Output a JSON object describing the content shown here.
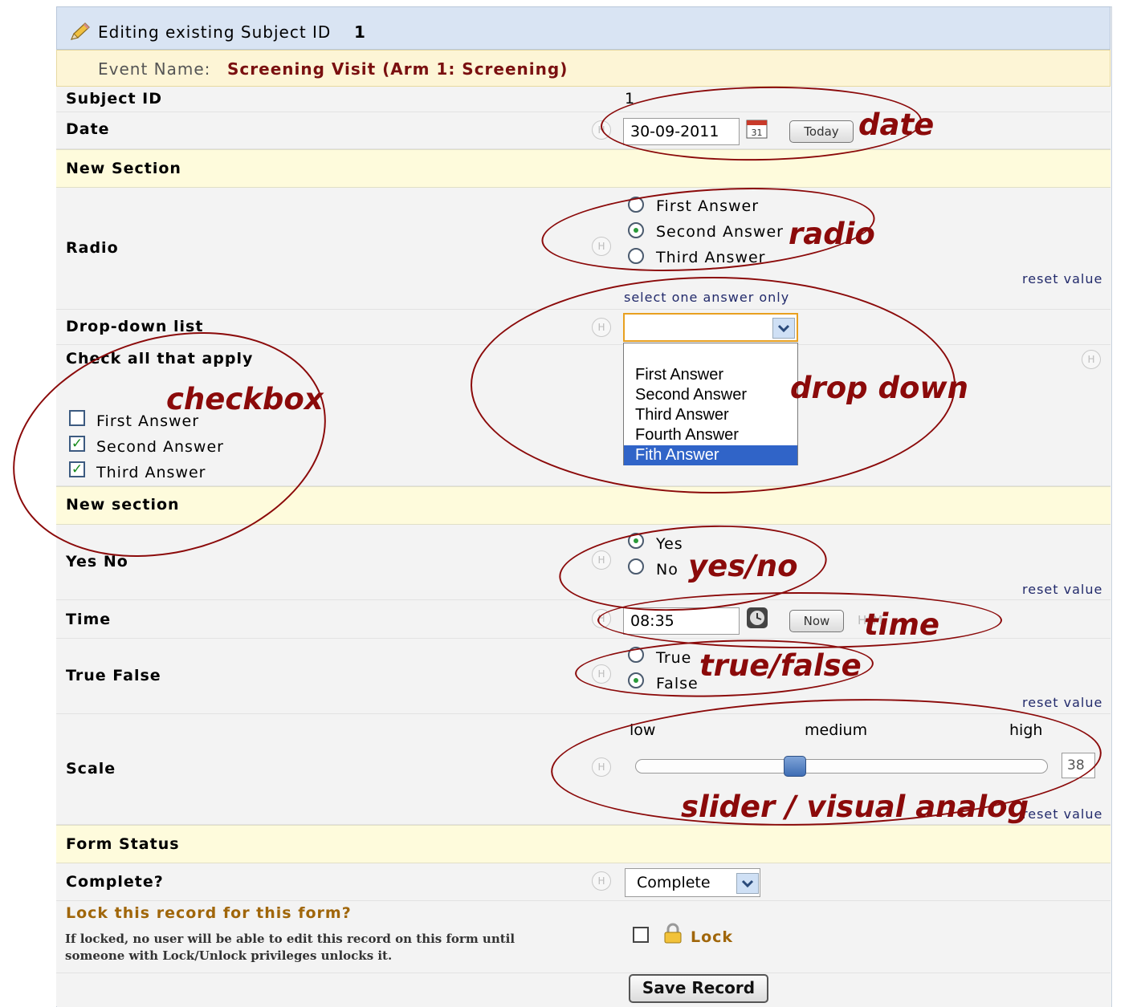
{
  "header": {
    "edit_prefix": "Editing existing Subject ID",
    "subject_number": "1"
  },
  "event": {
    "label": "Event Name:",
    "value": "Screening Visit (Arm 1: Screening)"
  },
  "fields": {
    "subject_id": {
      "label": "Subject ID",
      "value": "1"
    },
    "date": {
      "label": "Date",
      "value": "30-09-2011",
      "today_button": "Today",
      "calendar_day": "31"
    },
    "section1": "New Section",
    "radio": {
      "label": "Radio",
      "options": [
        "First Answer",
        "Second Answer",
        "Third Answer"
      ],
      "selected": "Second Answer",
      "reset": "reset value",
      "hint": "select one answer only"
    },
    "dropdown": {
      "label": "Drop-down list",
      "value": "",
      "options": [
        "First Answer",
        "Second Answer",
        "Third Answer",
        "Fourth Answer",
        "Fith Answer"
      ],
      "highlighted": "Fith Answer"
    },
    "checkbox": {
      "label": "Check all that apply",
      "options": [
        {
          "text": "First Answer",
          "checked": false
        },
        {
          "text": "Second Answer",
          "checked": true
        },
        {
          "text": "Third Answer",
          "checked": true
        }
      ]
    },
    "section2": "New section",
    "yesno": {
      "label": "Yes No",
      "options": [
        "Yes",
        "No"
      ],
      "selected": "Yes",
      "reset": "reset value"
    },
    "time": {
      "label": "Time",
      "value": "08:35",
      "now_button": "Now",
      "format_hint": "H:M"
    },
    "truefalse": {
      "label": "True False",
      "options": [
        "True",
        "False"
      ],
      "selected": "False",
      "reset": "reset value"
    },
    "scale": {
      "label": "Scale",
      "low": "low",
      "medium": "medium",
      "high": "high",
      "value": "38",
      "level": 0.38,
      "reset": "reset value"
    },
    "section3": "Form Status",
    "complete": {
      "label": "Complete?",
      "value": "Complete"
    },
    "lock": {
      "title": "Lock this record for this form?",
      "description_line1": "If locked, no user will be able to edit this record on this form until",
      "description_line2": "someone with Lock/Unlock privileges unlocks it.",
      "checkbox_label": "Lock",
      "checked": false
    },
    "save_button": "Save Record",
    "h_icon": "H"
  },
  "annotations": {
    "date": "date",
    "radio": "radio",
    "dropdown": "drop down",
    "checkbox": "checkbox",
    "yesno": "yes/no",
    "time": "time",
    "truefalse": "true/false",
    "slider": "slider / visual analog"
  },
  "colors": {
    "annotation": "#8b0a0a",
    "event_value": "#7a1010",
    "lock_title": "#a0660a",
    "link": "#222a6b",
    "dropdown_highlight": "#3064c8"
  },
  "icons": [
    "pencil-icon",
    "calendar-icon",
    "clock-icon",
    "lock-icon",
    "chevron-down-icon",
    "help-h-icon"
  ]
}
